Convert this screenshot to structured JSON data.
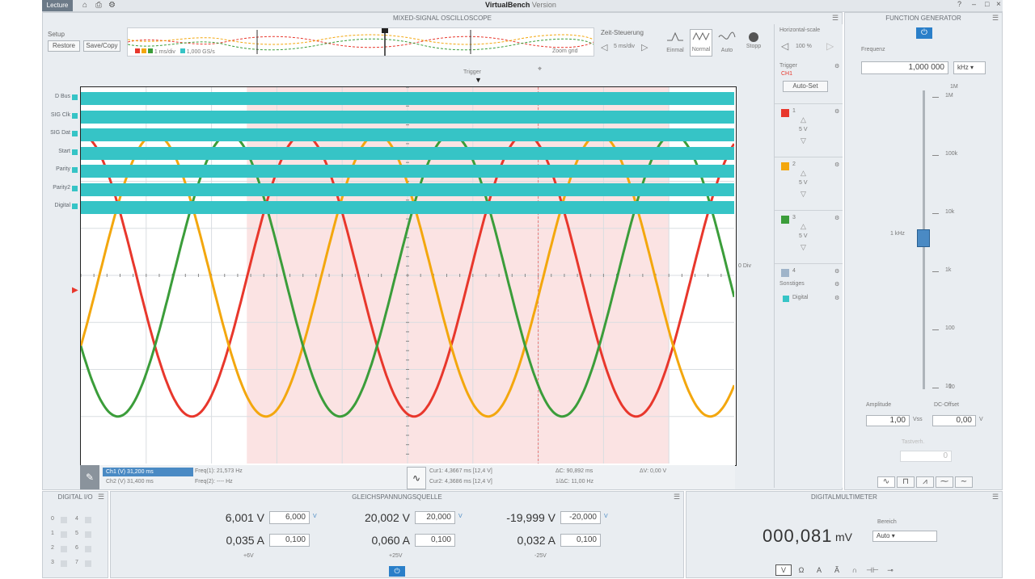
{
  "titlebar": {
    "tab": "Lecture",
    "app_title": "VirtualBench",
    "title_suffix": "Version",
    "controls": [
      "?",
      "–",
      "□",
      "×"
    ]
  },
  "mso": {
    "panel_title": "MIXED-SIGNAL OSCILLOSCOPE",
    "setup": {
      "label": "Setup",
      "btn1": "Restore",
      "btn2": "Save/Copy"
    },
    "overview": {
      "legend1": "1 ms/div",
      "legend2": "1,000 GS/s",
      "right_label": "Zoom grid"
    },
    "acq": {
      "label": "Zeit-Steuerung",
      "value": "5 ms/div",
      "modes": [
        "Einmal",
        "Normal",
        "Auto",
        "Stopp"
      ]
    },
    "trig_pos_label": "Trigger",
    "digital_lines": [
      "D Bus",
      "SIG Clk",
      "SIG Dat",
      "Start",
      "Parity",
      "Parity2",
      "Digital"
    ],
    "offset_label": "0 Div",
    "cursor_bar": {
      "a1": "Ch1 (V) 31,200 ms",
      "a2": "Ch2 (V) 31,400 ms",
      "m1": "Freq(1): 21,573 Hz",
      "m2": "Freq(2): ---- Hz",
      "c1": "Cur1: 4,3667 ms [12,4 V]",
      "c2": "Cur2: 4,3686 ms [12,4 V]",
      "d1": "ΔC: 90,892 ms",
      "d2": "1/ΔC: 11,00 Hz",
      "d3": "ΔV: 0,00 V"
    },
    "chart_data": {
      "type": "line",
      "xlim": [
        0,
        10
      ],
      "ylim": [
        -4,
        4
      ],
      "grid": true,
      "cursor_highlight": [
        2.54,
        9.0
      ],
      "series": [
        {
          "color": "#e8372c",
          "wave": "sine",
          "amplitude": 3,
          "period": 3.4,
          "phase_deg": 90
        },
        {
          "color": "#f3a70e",
          "wave": "sine",
          "amplitude": 3,
          "period": 3.4,
          "phase_deg": -30
        },
        {
          "color": "#3b9d3a",
          "wave": "sine",
          "amplitude": 3,
          "period": 3.4,
          "phase_deg": 210
        }
      ]
    }
  },
  "side": {
    "time_label": "Horizontal-scale",
    "zoom": "100 %",
    "trigger": {
      "label": "Trigger",
      "source": "CH1",
      "btn": "Auto-Set"
    },
    "channels": [
      {
        "num": "1",
        "color": "#e8372c",
        "scale": "5 V"
      },
      {
        "num": "2",
        "color": "#f3a70e",
        "scale": "5 V"
      },
      {
        "num": "3",
        "color": "#3b9d3a",
        "scale": "5 V"
      },
      {
        "num": "4",
        "color": "#9fb4c9",
        "scale": ""
      }
    ],
    "sonstiges": {
      "label": "Sonstiges",
      "item": "Digital"
    }
  },
  "fgen": {
    "title": "FUNCTION GENERATOR",
    "freq_label": "Frequenz",
    "freq_value": "1,000 000",
    "freq_unit": "kHz",
    "amp_label": "Amplitude",
    "amp_value": "1,00",
    "amp_unit": "Vss",
    "off_label": "DC-Offset",
    "off_value": "0,00",
    "off_unit": "V",
    "duty_label": "Tastverh.",
    "duty_value": "0",
    "slider_top": "1M",
    "slider_bottom": "10",
    "slider_readout": "1 kHz",
    "slider_ticks": [
      "1M",
      "100k",
      "10k",
      "1k",
      "100",
      "10"
    ],
    "waves": [
      "∿",
      "⊓",
      "⩘",
      "⁓",
      "∼"
    ]
  },
  "dio": {
    "title": "DIGITAL I/O",
    "pins": [
      "0",
      "1",
      "2",
      "3",
      "4",
      "5",
      "6",
      "7"
    ]
  },
  "dcp": {
    "title": "GLEICHSPANNUNGSQUELLE",
    "channels": [
      {
        "v": "6,001 V",
        "vset": "6,000",
        "i": "0,035 A",
        "iset": "0,100",
        "name": "+6V"
      },
      {
        "v": "20,002 V",
        "vset": "20,000",
        "i": "0,060 A",
        "iset": "0,100",
        "name": "+25V"
      },
      {
        "v": "-19,999 V",
        "vset": "-20,000",
        "i": "0,032 A",
        "iset": "0,100",
        "name": "-25V"
      }
    ],
    "vunit": "V",
    "power": "⏻"
  },
  "dmm": {
    "title": "DIGITALMULTIMETER",
    "reading": "000,081",
    "unit": "mV",
    "range_label": "Bereich",
    "range_value": "Auto",
    "modes": [
      "V",
      "Ω",
      "A",
      "Ã",
      "∩",
      "⊣⊢",
      "⊸"
    ]
  }
}
